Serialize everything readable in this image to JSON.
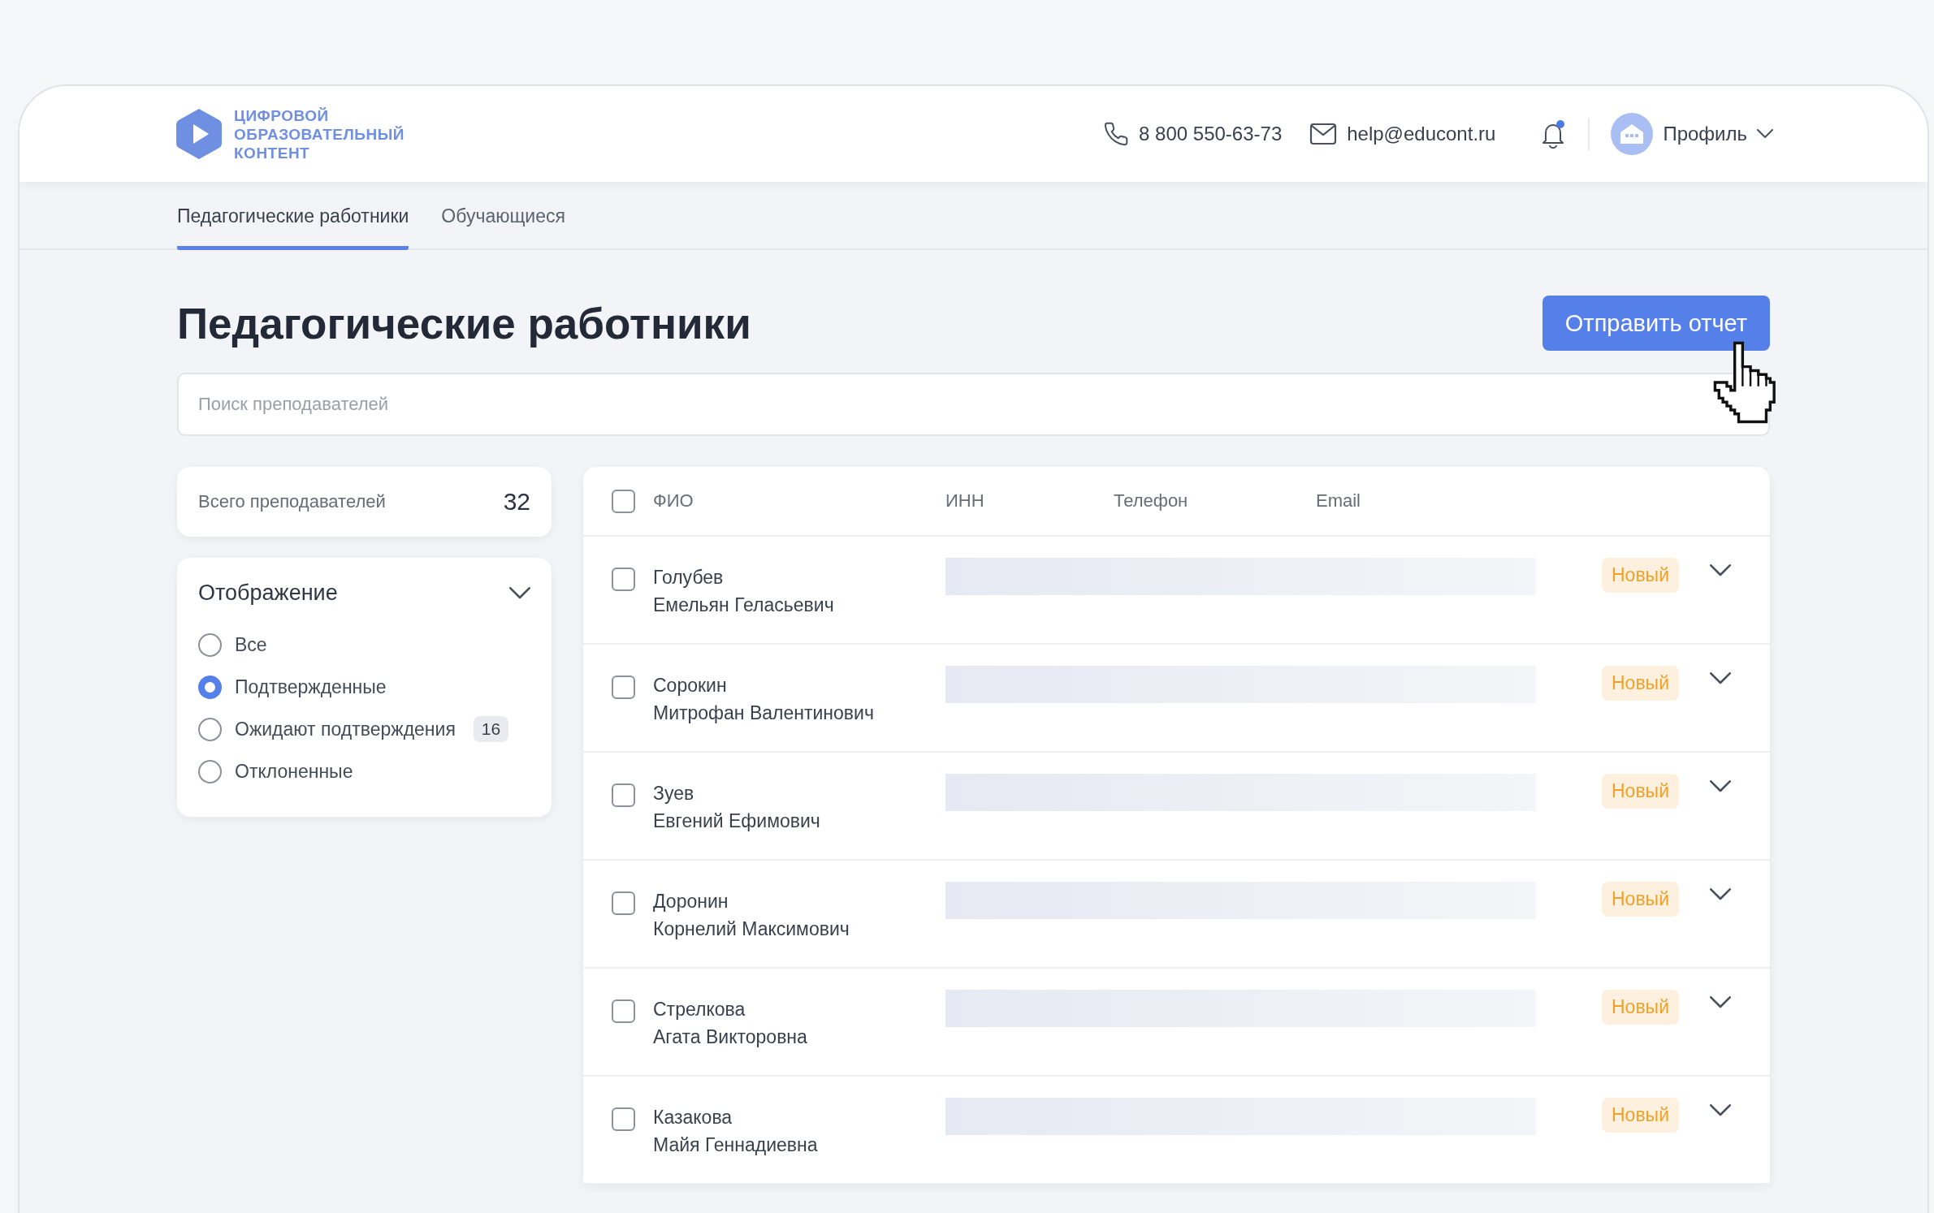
{
  "logo": {
    "lines": [
      "ЦИФРОВОЙ",
      "ОБРАЗОВАТЕЛЬНЫЙ",
      "КОНТЕНТ"
    ]
  },
  "contacts": {
    "phone": "8 800 550-63-73",
    "email": "help@educont.ru"
  },
  "notifications": {
    "unread": true
  },
  "profile": {
    "label": "Профиль"
  },
  "tabs": [
    {
      "label": "Педагогические работники",
      "selected": true
    },
    {
      "label": "Обучающиеся",
      "selected": false
    }
  ],
  "page_title": "Педагогические работники",
  "send_button": "Отправить отчет",
  "search": {
    "placeholder": "Поиск преподавателей"
  },
  "total": {
    "label": "Всего преподавателей",
    "value": "32"
  },
  "display_filter": {
    "title": "Отображение",
    "options": [
      {
        "label": "Все",
        "selected": false
      },
      {
        "label": "Подтвержденные",
        "selected": true
      },
      {
        "label": "Ожидают подтверждения",
        "selected": false,
        "count": "16"
      },
      {
        "label": "Отклоненные",
        "selected": false
      }
    ]
  },
  "table": {
    "select_all_checked": false,
    "columns": [
      "ФИО",
      "ИНН",
      "Телефон",
      "Email"
    ],
    "rows": [
      {
        "surname": "Голубев",
        "given_names": "Емельян Геласьевич",
        "checked": false,
        "status": "Новый",
        "expanded": false
      },
      {
        "surname": "Сорокин",
        "given_names": "Митрофан Валентинович",
        "checked": false,
        "status": "Новый",
        "expanded": false
      },
      {
        "surname": "Зуев",
        "given_names": "Евгений Ефимович",
        "checked": false,
        "status": "Новый",
        "expanded": false
      },
      {
        "surname": "Доронин",
        "given_names": "Корнелий Максимович",
        "checked": false,
        "status": "Новый",
        "expanded": false
      },
      {
        "surname": "Стрелкова",
        "given_names": "Агата Викторовна",
        "checked": false,
        "status": "Новый",
        "expanded": false
      },
      {
        "surname": "Казакова",
        "given_names": "Майя Геннадиевна",
        "checked": false,
        "status": "Новый",
        "expanded": false
      }
    ]
  }
}
